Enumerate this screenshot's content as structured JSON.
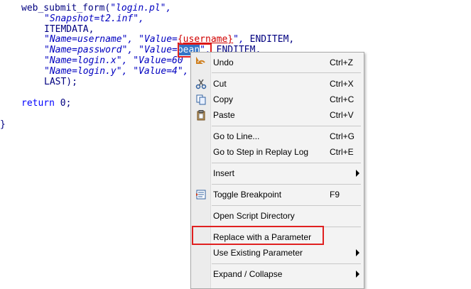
{
  "code": {
    "l1": {
      "a": "web_submit_form(",
      "b": "\"login.pl\","
    },
    "l2": "\"Snapshot=t2.inf\",",
    "l3": "ITEMDATA,",
    "l4": {
      "a": "\"Name=username\",",
      "b": "\"Value=",
      "c": "{username}",
      "d": "\",",
      "e": "ENDITEM,"
    },
    "l5": {
      "a": "\"Name=password\",",
      "b": "\"Value=",
      "c": "bean",
      "d": "\",",
      "e": "ENDITEM,"
    },
    "l6": {
      "a": "\"Name=login.x\",",
      "b": "\"Value=60"
    },
    "l7": {
      "a": "\"Name=login.y\",",
      "b": "\"Value=4\","
    },
    "l8": "LAST);",
    "l9": {
      "a": "return",
      "b": "0;"
    },
    "l10": "}"
  },
  "context_menu": {
    "undo": {
      "label": "Undo",
      "shortcut": "Ctrl+Z",
      "icon": "undo-icon"
    },
    "cut": {
      "label": "Cut",
      "shortcut": "Ctrl+X",
      "icon": "scissors-icon"
    },
    "copy": {
      "label": "Copy",
      "shortcut": "Ctrl+C",
      "icon": "copy-icon"
    },
    "paste": {
      "label": "Paste",
      "shortcut": "Ctrl+V",
      "icon": "clipboard-icon"
    },
    "go_to_line": {
      "label": "Go to Line...",
      "shortcut": "Ctrl+G"
    },
    "go_to_step": {
      "label": "Go to Step in Replay Log",
      "shortcut": "Ctrl+E"
    },
    "insert": {
      "label": "Insert"
    },
    "toggle_breakpoint": {
      "label": "Toggle Breakpoint",
      "shortcut": "F9",
      "icon": "breakpoint-icon"
    },
    "open_script_dir": {
      "label": "Open Script Directory"
    },
    "replace_param": {
      "label": "Replace with a Parameter"
    },
    "use_existing": {
      "label": "Use Existing Parameter"
    },
    "expand_collapse": {
      "label": "Expand / Collapse"
    }
  },
  "colors": {
    "highlight_box": "#e02020",
    "selection": "#3375c8"
  }
}
